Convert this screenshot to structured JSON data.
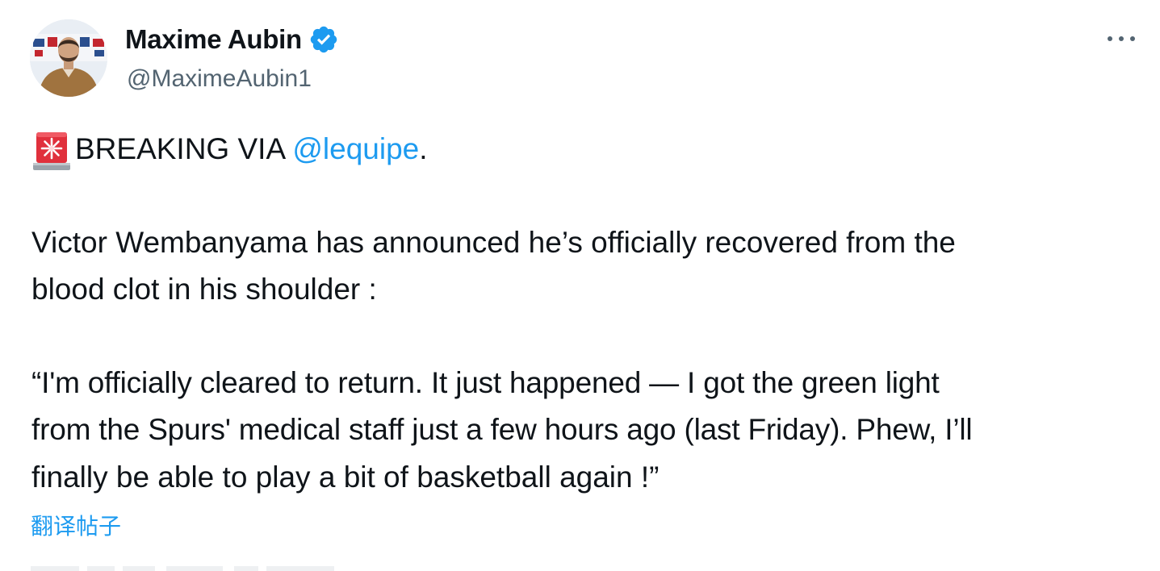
{
  "author": {
    "name": "Maxime Aubin",
    "handle": "@MaximeAubin1",
    "verified": true
  },
  "tweet": {
    "line1_text": "BREAKING VIA ",
    "mention": "@lequipe",
    "line1_suffix": ".",
    "para2_line1": "Victor Wembanyama has announced he’s officially recovered from the",
    "para2_line2": "blood clot in his shoulder :",
    "quote_line1": "“I'm officially cleared to return. It just happened — I got the green light",
    "quote_line2": "from the Spurs' medical staff just a few hours ago (last Friday). Phew, I’ll",
    "quote_line3": "finally be able to play a bit of basketball again !”"
  },
  "translate_label": "翻译帖子",
  "icons": {
    "verified": "verified-badge-icon",
    "more": "more-options-icon",
    "alert": "rotating-light-emoji-icon"
  },
  "colors": {
    "link": "#1d9bf0",
    "verified": "#1d9bf0",
    "secondary_text": "#536471",
    "primary_text": "#0f1419"
  }
}
